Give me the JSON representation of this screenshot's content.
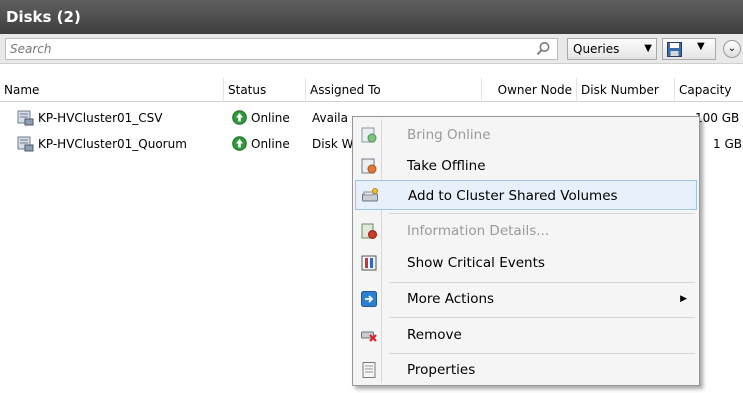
{
  "panel": {
    "title": "Disks (2)"
  },
  "toolbar": {
    "search_placeholder": "Search",
    "queries_label": "Queries"
  },
  "columns": [
    "Name",
    "Status",
    "Assigned To",
    "Owner Node",
    "Disk Number",
    "Capacity"
  ],
  "rows": [
    {
      "name": "KP-HVCluster01_CSV",
      "status": "Online",
      "assigned": "Availa",
      "owner": "",
      "disk": "",
      "capacity": "100 GB"
    },
    {
      "name": "KP-HVCluster01_Quorum",
      "status": "Online",
      "assigned": "Disk W",
      "owner": "",
      "disk": "",
      "capacity": "1 GB"
    }
  ],
  "context_menu": {
    "items": [
      {
        "label": "Bring Online",
        "icon": "bring-online-icon",
        "disabled": true
      },
      {
        "label": "Take Offline",
        "icon": "take-offline-icon",
        "disabled": false
      },
      {
        "label": "Add to Cluster Shared Volumes",
        "icon": "add-csv-icon",
        "disabled": false,
        "highlighted": true
      },
      {
        "label": "Information Details...",
        "icon": "info-details-icon",
        "disabled": true
      },
      {
        "label": "Show Critical Events",
        "icon": "critical-events-icon",
        "disabled": false
      },
      {
        "label": "More Actions",
        "icon": "more-actions-icon",
        "disabled": false,
        "submenu": true
      },
      {
        "label": "Remove",
        "icon": "remove-icon",
        "disabled": false
      },
      {
        "label": "Properties",
        "icon": "properties-icon",
        "disabled": false
      }
    ]
  },
  "colors": {
    "title_bar": "#4a4a4a",
    "highlight_bg": "#e8f1fb",
    "highlight_border": "#9dc4ea",
    "online_green": "#2f9a3a"
  }
}
